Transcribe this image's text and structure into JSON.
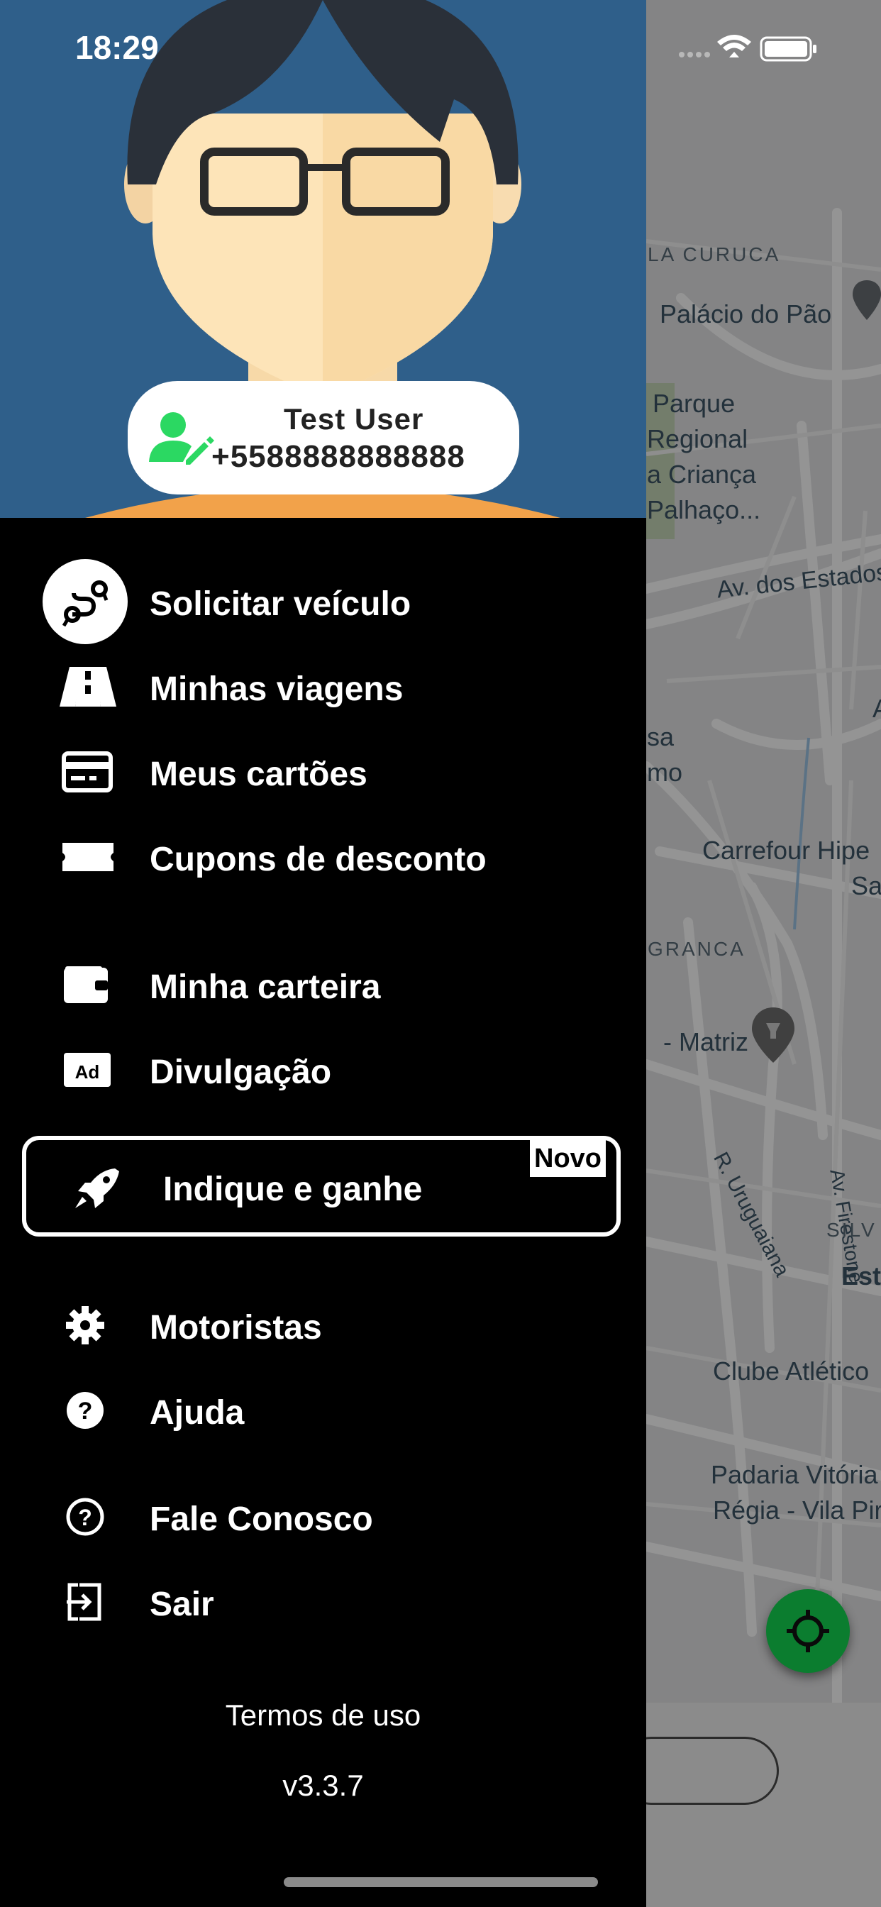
{
  "status_bar": {
    "time": "18:29"
  },
  "user": {
    "name": "Test User",
    "phone": "+5588888888888"
  },
  "menu": {
    "solicitar": "Solicitar veículo",
    "viagens": "Minhas viagens",
    "cartoes": "Meus cartões",
    "cupons": "Cupons de desconto",
    "carteira": "Minha carteira",
    "divulgacao": "Divulgação",
    "indique": "Indique e ganhe",
    "novo_badge": "Novo",
    "motoristas": "Motoristas",
    "ajuda": "Ajuda",
    "fale_conosco": "Fale Conosco",
    "sair": "Sair"
  },
  "footer": {
    "terms": "Termos de uso",
    "version": "v3.3.7"
  },
  "map": {
    "labels": [
      "LA CURUCA",
      "Palácio do Pão",
      "Parque",
      "Regional",
      "a Criança",
      "Palhaço...",
      "Av. dos Estados",
      "sa",
      "mo",
      "Carrefour Hipe",
      "Sa",
      "GRANCA",
      "- Matriz",
      "R. Uruguaiana",
      "Av. Firestone",
      "SILV",
      "Est",
      "Clube Atlético",
      "Padaria Vitória",
      "Régia - Vila Pire",
      "A"
    ]
  },
  "colors": {
    "drawer_bg": "#000000",
    "header_bg": "#2f5f8a",
    "accent_green": "#0b7d2f",
    "user_icon_green": "#2bd862"
  },
  "icons": {
    "solicitar": "route-icon",
    "viagens": "road-icon",
    "cartoes": "credit-card-icon",
    "cupons": "ticket-icon",
    "carteira": "wallet-icon",
    "divulgacao": "ad-icon",
    "indique": "rocket-icon",
    "motoristas": "gear-icon",
    "ajuda": "help-circle-icon",
    "fale_conosco": "help-outline-icon",
    "sair": "logout-icon"
  }
}
